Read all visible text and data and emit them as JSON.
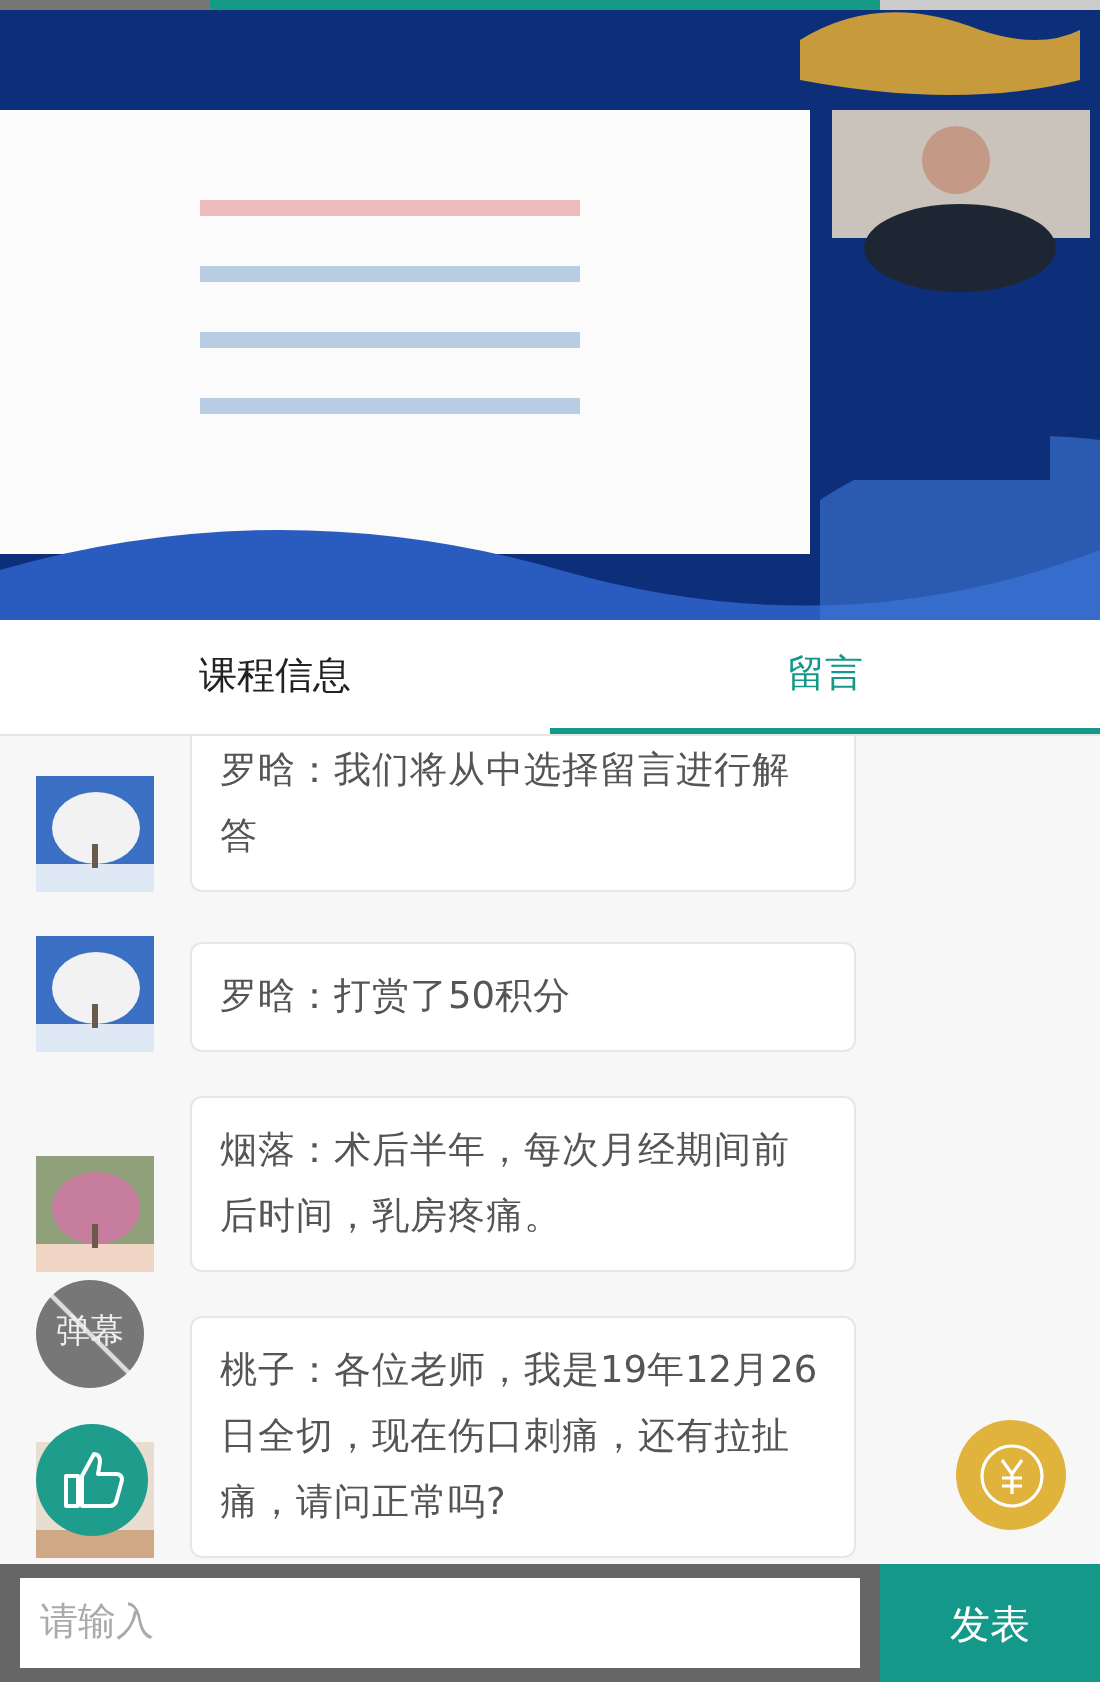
{
  "tabs": [
    {
      "label": "课程信息",
      "selected": false
    },
    {
      "label": "留言",
      "selected": true
    }
  ],
  "messages": [
    {
      "text": "罗晗：我们将从中选择留言进行解答"
    },
    {
      "text": "罗晗：打赏了50积分"
    },
    {
      "text": "烟落：术后半年，每次月经期间前后时间，乳房疼痛。"
    },
    {
      "text": "桃子：各位老师，我是19年12月26日全切，现在伤口刺痛，还有拉扯痛，请问正常吗?"
    }
  ],
  "danmaku_toggle": {
    "label": "弹幕",
    "on": false
  },
  "composer": {
    "placeholder": "请输入",
    "send": "发表"
  }
}
